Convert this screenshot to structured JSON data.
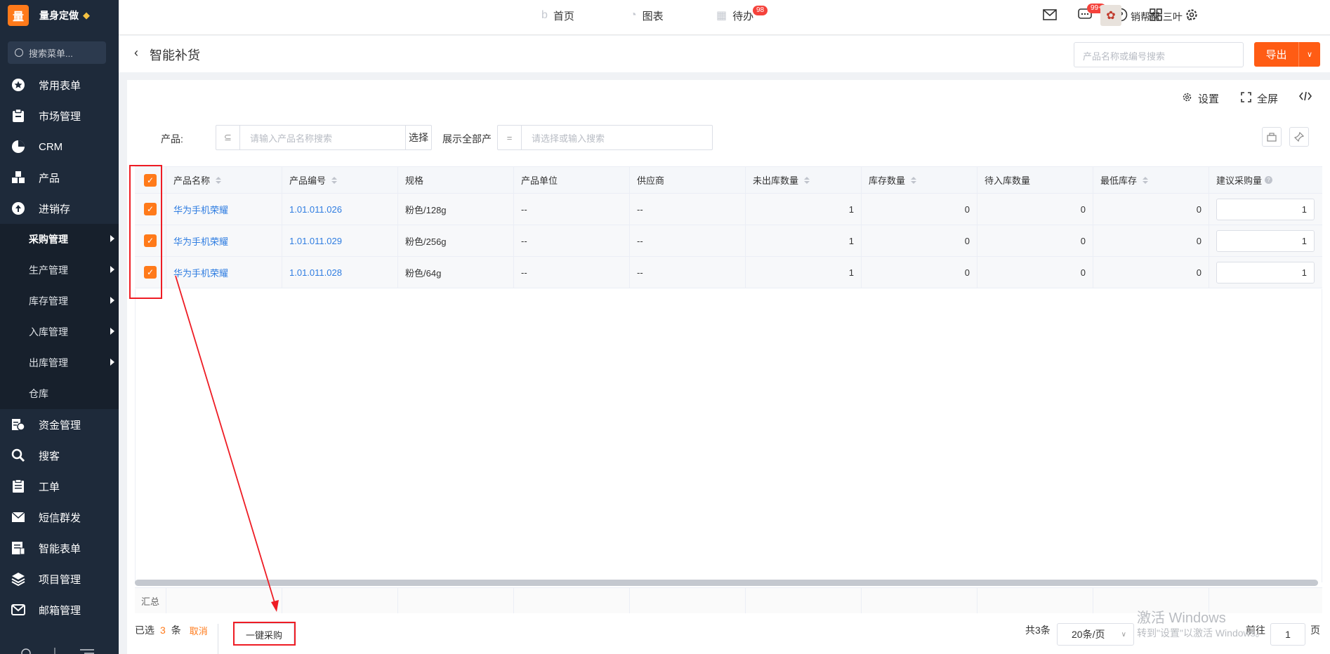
{
  "brand": {
    "logo": "量",
    "name": "量身定做"
  },
  "sidebar": {
    "search_placeholder": "搜索菜单...",
    "items": [
      {
        "label": "常用表单",
        "icon": "star-icon"
      },
      {
        "label": "市场管理",
        "icon": "clipboard-icon"
      },
      {
        "label": "CRM",
        "icon": "pie-icon"
      },
      {
        "label": "产品",
        "icon": "cubes-icon"
      },
      {
        "label": "进销存",
        "icon": "upload-cloud-icon"
      }
    ],
    "sub_items": [
      {
        "label": "采购管理",
        "has_arrow": true
      },
      {
        "label": "生产管理",
        "has_arrow": true
      },
      {
        "label": "库存管理",
        "has_arrow": true
      },
      {
        "label": "入库管理",
        "has_arrow": true
      },
      {
        "label": "出库管理",
        "has_arrow": true
      },
      {
        "label": "仓库",
        "has_arrow": false
      }
    ],
    "items_after": [
      {
        "label": "资金管理",
        "icon": "finance-icon"
      },
      {
        "label": "搜客",
        "icon": "search-icon"
      },
      {
        "label": "工单",
        "icon": "clipboard-list-icon"
      },
      {
        "label": "短信群发",
        "icon": "envelope-icon"
      },
      {
        "label": "智能表单",
        "icon": "form-icon"
      },
      {
        "label": "项目管理",
        "icon": "layers-icon"
      },
      {
        "label": "邮箱管理",
        "icon": "mail-icon"
      }
    ]
  },
  "topbar": {
    "nav": [
      {
        "label": "首页",
        "icon": "home-icon"
      },
      {
        "label": "图表",
        "icon": "chart-icon"
      },
      {
        "label": "待办",
        "icon": "calendar-icon",
        "badge": "98"
      }
    ],
    "message_badge": "99+",
    "user_name": "销帮帮 三叶"
  },
  "page": {
    "title": "智能补货",
    "search_placeholder": "产品名称或编号搜索",
    "export_label": "导出"
  },
  "toolbar": {
    "settings_label": "设置",
    "fullscreen_label": "全屏"
  },
  "filters": {
    "product_label": "产品:",
    "product_placeholder": "请输入产品名称搜索",
    "select_label": "选择",
    "show_all_label": "展示全部产",
    "show_all_placeholder": "请选择或输入搜索",
    "eq_symbol": "="
  },
  "table": {
    "headers": [
      "产品名称",
      "产品编号",
      "规格",
      "产品单位",
      "供应商",
      "未出库数量",
      "库存数量",
      "待入库数量",
      "最低库存",
      "建议采购量"
    ],
    "rows": [
      {
        "name": "华为手机荣耀",
        "code": "1.01.011.026",
        "spec": "粉色/128g",
        "unit": "--",
        "supplier": "--",
        "out": "1",
        "stock": "0",
        "pending": "0",
        "min": "0",
        "suggest": "1"
      },
      {
        "name": "华为手机荣耀",
        "code": "1.01.011.029",
        "spec": "粉色/256g",
        "unit": "--",
        "supplier": "--",
        "out": "1",
        "stock": "0",
        "pending": "0",
        "min": "0",
        "suggest": "1"
      },
      {
        "name": "华为手机荣耀",
        "code": "1.01.011.028",
        "spec": "粉色/64g",
        "unit": "--",
        "supplier": "--",
        "out": "1",
        "stock": "0",
        "pending": "0",
        "min": "0",
        "suggest": "1"
      }
    ],
    "summary_label": "汇总"
  },
  "footer": {
    "selected_prefix": "已选",
    "selected_count": "3",
    "selected_suffix": "条",
    "cancel_label": "取消",
    "one_click_buy": "一键采购",
    "total": "共3条",
    "page_size": "20条/页",
    "goto_label": "前往",
    "goto_value": "1",
    "page_suffix": "页"
  },
  "watermark": {
    "line1": "激活 Windows",
    "line2": "转到\"设置\"以激活 Windows。"
  },
  "colors": {
    "accent": "#ff7a1a",
    "sidebar": "#1e2a3a",
    "link": "#2f7de1",
    "annotation": "#ee1c24"
  }
}
